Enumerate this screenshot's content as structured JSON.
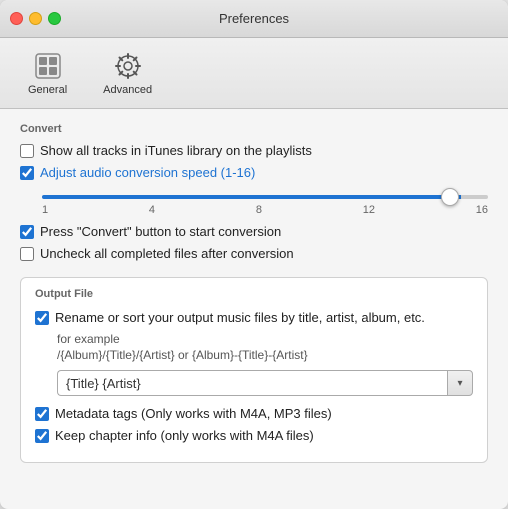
{
  "window": {
    "title": "Preferences"
  },
  "toolbar": {
    "buttons": [
      {
        "id": "general",
        "label": "General",
        "active": false
      },
      {
        "id": "advanced",
        "label": "Advanced",
        "active": true
      }
    ]
  },
  "convert_section": {
    "header": "Convert",
    "checkboxes": [
      {
        "id": "show-all-tracks",
        "label": "Show all tracks in iTunes library on the playlists",
        "checked": false
      },
      {
        "id": "adjust-audio",
        "label": "Adjust audio conversion speed (1-16)",
        "checked": true
      },
      {
        "id": "press-convert",
        "label": "Press \"Convert\" button to start conversion",
        "checked": true
      },
      {
        "id": "uncheck-completed",
        "label": "Uncheck all completed files after conversion",
        "checked": false
      }
    ],
    "slider": {
      "min": 1,
      "max": 16,
      "value": 15,
      "labels": [
        "1",
        "4",
        "8",
        "12",
        "16"
      ]
    }
  },
  "output_section": {
    "header": "Output File",
    "rename_checkbox": {
      "id": "rename-sort",
      "label": "Rename or sort your output music files by title, artist, album, etc.",
      "checked": true
    },
    "example_label": "for example",
    "format_example": "/{Album}/{Title}/{Artist} or {Album}-{Title}-{Artist}",
    "input_value": "{Title} {Artist}",
    "metadata_checkbox": {
      "id": "metadata-tags",
      "label": "Metadata tags (Only works with M4A, MP3 files)",
      "checked": true
    },
    "chapter_checkbox": {
      "id": "keep-chapter",
      "label": "Keep chapter info (only works with  M4A files)",
      "checked": true
    }
  },
  "icons": {
    "general": "⊞",
    "advanced": "⚙",
    "chevron_down": "▾"
  },
  "colors": {
    "accent": "#1e73d2",
    "checked_bg": "#1e73d2"
  }
}
